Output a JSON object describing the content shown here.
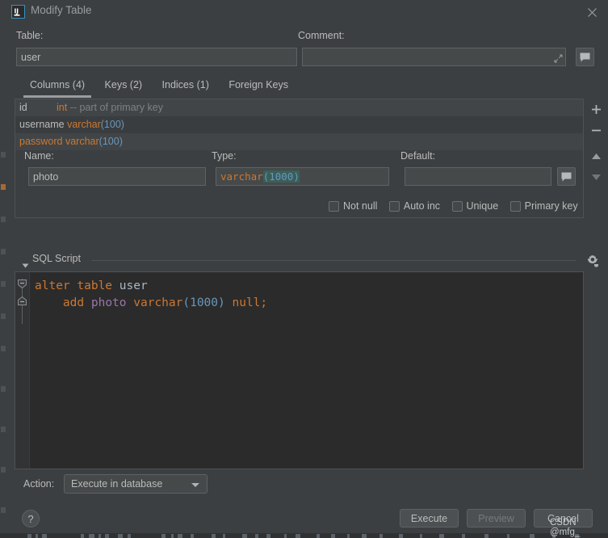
{
  "window": {
    "title": "Modify Table",
    "logo_icon": "intellij-idea-icon",
    "close_icon": "close-icon"
  },
  "form": {
    "table_label": "Table:",
    "table_value": "user",
    "table_placeholder": "",
    "comment_label": "Comment:",
    "comment_value": "",
    "comment_placeholder": "",
    "comment_expand_icon": "expand-icon",
    "comment_button_icon": "comment-icon"
  },
  "tabs": [
    {
      "label": "Columns (4)",
      "active": true
    },
    {
      "label": "Keys (2)",
      "active": false
    },
    {
      "label": "Indices (1)",
      "active": false
    },
    {
      "label": "Foreign Keys",
      "active": false
    }
  ],
  "columns": [
    {
      "name": "id",
      "type": "int",
      "length": "",
      "comment": "-- part of primary key",
      "highlight": false,
      "pad": true
    },
    {
      "name": "username",
      "type": "varchar",
      "length": "(100)",
      "comment": "",
      "highlight": false,
      "pad": false
    },
    {
      "name": "password",
      "type": "varchar",
      "length": "(100)",
      "comment": "",
      "highlight": true,
      "pad": false
    }
  ],
  "side_tools": [
    {
      "name": "add-column-button",
      "icon": "plus-icon"
    },
    {
      "name": "remove-column-button",
      "icon": "minus-icon"
    },
    {
      "name": "move-up-button",
      "icon": "arrow-up-icon"
    },
    {
      "name": "move-down-button",
      "icon": "arrow-down-icon"
    }
  ],
  "editor": {
    "name_label": "Name:",
    "name_value": "photo",
    "type_label": "Type:",
    "type_base": "varchar",
    "type_length": "(1000)",
    "default_label": "Default:",
    "default_value": "",
    "default_button_icon": "comment-icon"
  },
  "checkboxes": [
    {
      "label": "Not null",
      "checked": false
    },
    {
      "label": "Auto inc",
      "checked": false
    },
    {
      "label": "Unique",
      "checked": false
    },
    {
      "label": "Primary key",
      "checked": false
    }
  ],
  "sql": {
    "section_title": "SQL Script",
    "collapse_icon": "chevron-down-icon",
    "settings_icon": "gear-icon",
    "line1": {
      "kw1": "alter",
      "kw2": "table",
      "ident": "user"
    },
    "line2": {
      "indent": "    ",
      "kw1": "add",
      "column": "photo",
      "type": "varchar",
      "length": "(1000)",
      "kw2": "null;"
    }
  },
  "action": {
    "label": "Action:",
    "selected": "Execute in database",
    "caret_icon": "chevron-down-icon"
  },
  "footer": {
    "help_label": "?",
    "execute_label": "Execute",
    "preview_label": "Preview",
    "cancel_label": "Cancel",
    "preview_disabled": true,
    "watermark": "CSDN @mfg_"
  },
  "colors": {
    "bg": "#3c3f41",
    "field_bg": "#45494a",
    "text": "#bbbbbb",
    "keyword": "#cc7832",
    "number": "#6897bb",
    "column": "#9876aa",
    "identifier": "#a9b7c6",
    "comment": "#808080",
    "editor_bg": "#2b2b2b",
    "accent": "#3592c4"
  }
}
